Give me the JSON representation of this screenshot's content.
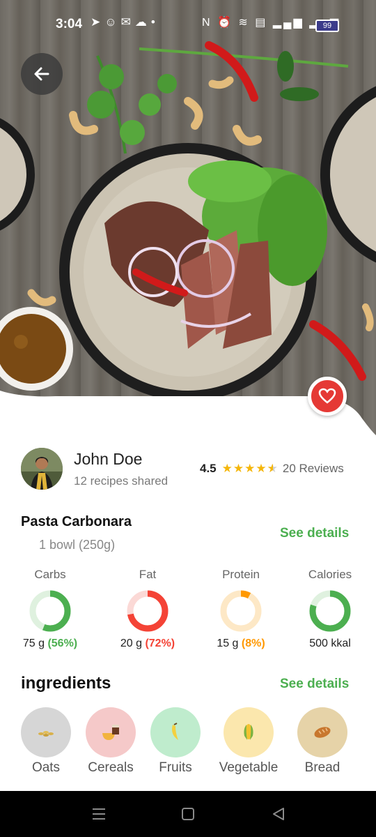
{
  "status_bar": {
    "time": "3:04",
    "left_icons": [
      "telegram-icon",
      "snapchat-icon",
      "chat-icon",
      "messenger-icon",
      "dot-icon"
    ],
    "right_icons": [
      "nfc-icon",
      "alarm-icon",
      "wifi-icon",
      "volte-icon",
      "signal-icon",
      "signal-icon"
    ],
    "battery": "99"
  },
  "author": {
    "name": "John Doe",
    "subtitle": "12 recipes shared"
  },
  "rating": {
    "value": "4.5",
    "stars": 4.5,
    "reviews": "20 Reviews"
  },
  "recipe": {
    "title": "Pasta Carbonara",
    "serving": "1 bowl (250g)",
    "see_details": "See details"
  },
  "nutrition": [
    {
      "label": "Carbs",
      "amount": "75 g",
      "percent": "(56%)",
      "fraction": 0.56,
      "color": "#4caf50",
      "track": "#dff1df"
    },
    {
      "label": "Fat",
      "amount": "20 g",
      "percent": "(72%)",
      "fraction": 0.72,
      "color": "#f44336",
      "track": "#fbd9d6"
    },
    {
      "label": "Protein",
      "amount": "15 g",
      "percent": "(8%)",
      "fraction": 0.08,
      "color": "#ff9800",
      "track": "#fde8c6"
    },
    {
      "label": "Calories",
      "amount": "500 kkal",
      "percent": "",
      "fraction": 0.8,
      "color": "#4caf50",
      "track": "#dff1df"
    }
  ],
  "ingredients": {
    "heading": "ingredients",
    "see_details": "See details",
    "items": [
      {
        "label": "Oats",
        "icon": "oats-icon",
        "bg": "#d6d6d6"
      },
      {
        "label": "Cereals",
        "icon": "cereals-icon",
        "bg": "#f5c9c9"
      },
      {
        "label": "Fruits",
        "icon": "banana-icon",
        "bg": "#bfeccd"
      },
      {
        "label": "Vegetable",
        "icon": "corn-icon",
        "bg": "#fbe7ad"
      },
      {
        "label": "Bread",
        "icon": "bread-icon",
        "bg": "#e6d3a8"
      }
    ]
  },
  "colors": {
    "accent_green": "#4caf50",
    "favorite_red": "#e53935",
    "star_yellow": "#f5b60a"
  }
}
